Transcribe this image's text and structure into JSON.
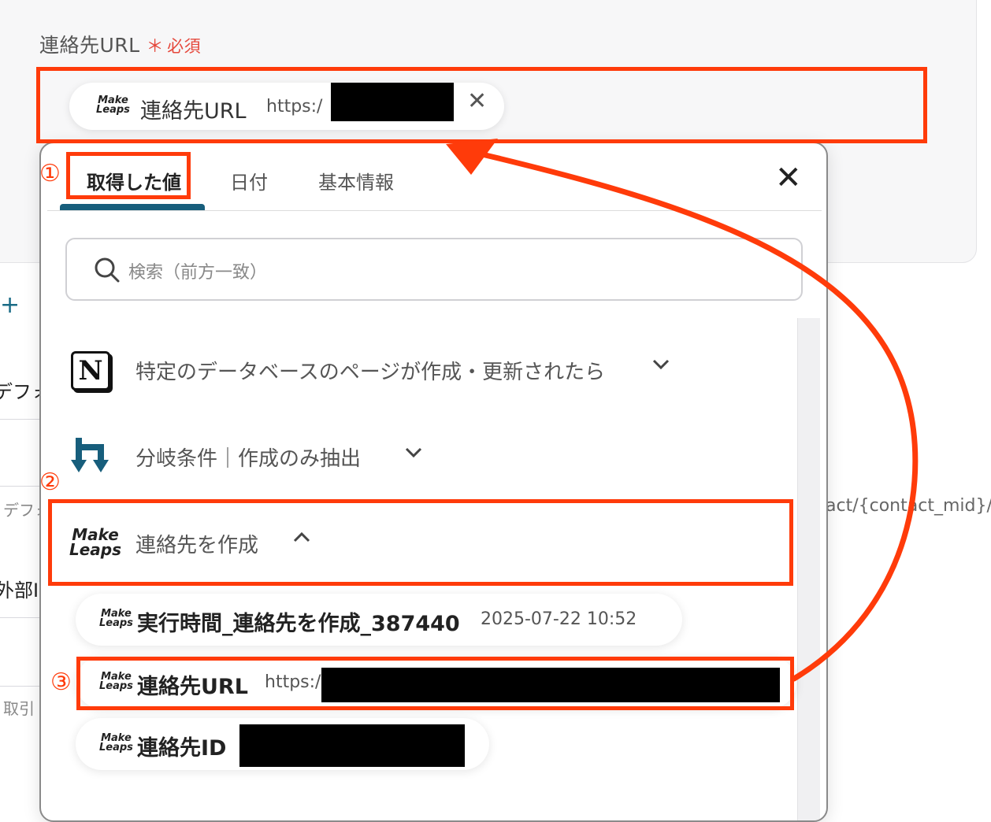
{
  "field": {
    "label": "連絡先URL",
    "required_mark": "＊",
    "required_text": "必須"
  },
  "selected_chip": {
    "logo_line1": "Make",
    "logo_line2": "Leaps",
    "name": "連絡先URL",
    "value_prefix": "https:/"
  },
  "background": {
    "plus": "+",
    "def_label": "デフォ",
    "def_hint": "デフォ",
    "ext_label": "外部I",
    "tori": "取引",
    "right_url": "act/{contact_mid}/"
  },
  "popup": {
    "tabs": [
      {
        "label": "取得した値",
        "active": true
      },
      {
        "label": "日付",
        "active": false
      },
      {
        "label": "基本情報",
        "active": false
      }
    ],
    "close": "✕",
    "search_placeholder": "検索（前方一致）",
    "groups": [
      {
        "title": "特定のデータベースのページが作成・更新されたら",
        "icon": "notion-icon",
        "expanded": false,
        "logo_text": "N"
      },
      {
        "title": "分岐条件｜作成のみ抽出",
        "icon": "branch-icon",
        "expanded": false
      },
      {
        "title": "連絡先を作成",
        "icon": "makeleaps-icon",
        "expanded": true,
        "logo_line1": "Make",
        "logo_line2": "Leaps"
      }
    ],
    "items": [
      {
        "name": "実行時間_連絡先を作成_387440",
        "value": "2025-07-22 10:52",
        "logo_line1": "Make",
        "logo_line2": "Leaps"
      },
      {
        "name": "連絡先URL",
        "value": "https:/",
        "logo_line1": "Make",
        "logo_line2": "Leaps"
      },
      {
        "name": "連絡先ID",
        "value": "",
        "logo_line1": "Make",
        "logo_line2": "Leaps"
      }
    ]
  },
  "annotations": {
    "step1": "①",
    "step2": "②",
    "step3": "③",
    "color": "#ff3b0a"
  },
  "colors": {
    "accent": "#175e7c",
    "required": "#e5483c",
    "annotation": "#ff3b0a"
  }
}
